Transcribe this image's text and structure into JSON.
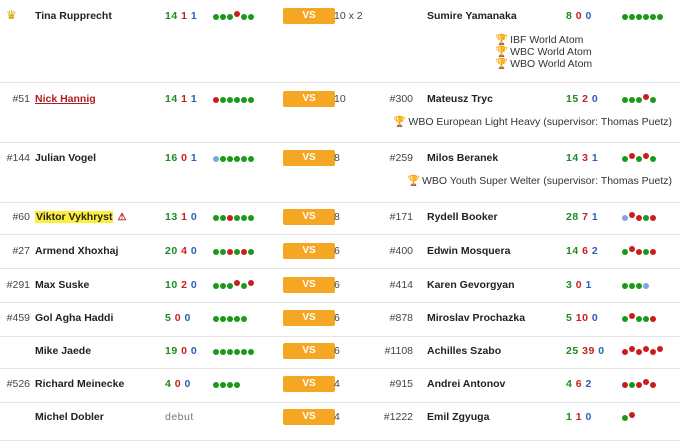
{
  "vs_label": "VS",
  "bouts": [
    {
      "rank_a": "",
      "name_a": "Tina Rupprecht",
      "rec_a": [
        "14",
        "1",
        "1"
      ],
      "form_a": "wwwlww",
      "rounds": "10 x 2",
      "rank_b": "",
      "name_b": "Sumire Yamanaka",
      "rec_b": [
        "8",
        "0",
        "0"
      ],
      "form_b": "wwwwww",
      "titles": [
        "IBF World Atom",
        "WBC World Atom",
        "WBO World Atom"
      ]
    },
    {
      "rank_a": "#51",
      "name_a": "Nick Hannig",
      "rec_a": [
        "14",
        "1",
        "1"
      ],
      "form_a": "lwwwww",
      "rounds": "10",
      "rank_b": "#300",
      "name_b": "Mateusz Tryc",
      "rec_b": [
        "15",
        "2",
        "0"
      ],
      "form_b": "wwwlw",
      "titles": [
        "WBO European Light Heavy (supervisor: Thomas Puetz)"
      ]
    },
    {
      "rank_a": "#144",
      "name_a": "Julian Vogel",
      "rec_a": [
        "16",
        "0",
        "1"
      ],
      "form_a": "dwwwww",
      "rounds": "8",
      "rank_b": "#259",
      "name_b": "Milos Beranek",
      "rec_b": [
        "14",
        "3",
        "1"
      ],
      "form_b": "wlwlw",
      "titles": [
        "WBO Youth Super Welter (supervisor: Thomas Puetz)"
      ]
    },
    {
      "rank_a": "#60",
      "name_a": "Viktor Vykhryst",
      "rec_a": [
        "13",
        "1",
        "0"
      ],
      "form_a": "wwlwww",
      "rounds": "8",
      "rank_b": "#171",
      "name_b": "Rydell Booker",
      "rec_b": [
        "28",
        "7",
        "1"
      ],
      "form_b": "dllwl",
      "titles": []
    },
    {
      "rank_a": "#27",
      "name_a": "Armend Xhoxhaj",
      "rec_a": [
        "20",
        "4",
        "0"
      ],
      "form_a": "wwlwlw",
      "rounds": "6",
      "rank_b": "#400",
      "name_b": "Edwin Mosquera",
      "rec_b": [
        "14",
        "6",
        "2"
      ],
      "form_b": "wllwl",
      "titles": []
    },
    {
      "rank_a": "#291",
      "name_a": "Max Suske",
      "rec_a": [
        "10",
        "2",
        "0"
      ],
      "form_a": "wwwlwl",
      "rounds": "6",
      "rank_b": "#414",
      "name_b": "Karen Gevorgyan",
      "rec_b": [
        "3",
        "0",
        "1"
      ],
      "form_b": "wwwd",
      "titles": []
    },
    {
      "rank_a": "#459",
      "name_a": "Gol Agha Haddi",
      "rec_a": [
        "5",
        "0",
        "0"
      ],
      "form_a": "wwwww",
      "rounds": "6",
      "rank_b": "#878",
      "name_b": "Miroslav Prochazka",
      "rec_b": [
        "5",
        "10",
        "0"
      ],
      "form_b": "wlwwl",
      "titles": []
    },
    {
      "rank_a": "",
      "name_a": "Mike Jaede",
      "rec_a": [
        "19",
        "0",
        "0"
      ],
      "form_a": "wwwwww",
      "rounds": "6",
      "rank_b": "#1108",
      "name_b": "Achilles Szabo",
      "rec_b": [
        "25",
        "39",
        "0"
      ],
      "form_b": "llllll",
      "titles": []
    },
    {
      "rank_a": "#526",
      "name_a": "Richard Meinecke",
      "rec_a": [
        "4",
        "0",
        "0"
      ],
      "form_a": "wwww",
      "rounds": "4",
      "rank_b": "#915",
      "name_b": "Andrei Antonov",
      "rec_b": [
        "4",
        "6",
        "2"
      ],
      "form_b": "lwlll",
      "titles": []
    },
    {
      "rank_a": "",
      "name_a": "Michel Dobler",
      "rec_a": [],
      "debut": "debut",
      "form_a": "",
      "rounds": "4",
      "rank_b": "#1222",
      "name_b": "Emil Zgyuga",
      "rec_b": [
        "1",
        "1",
        "0"
      ],
      "form_b": "wl",
      "titles": []
    }
  ]
}
